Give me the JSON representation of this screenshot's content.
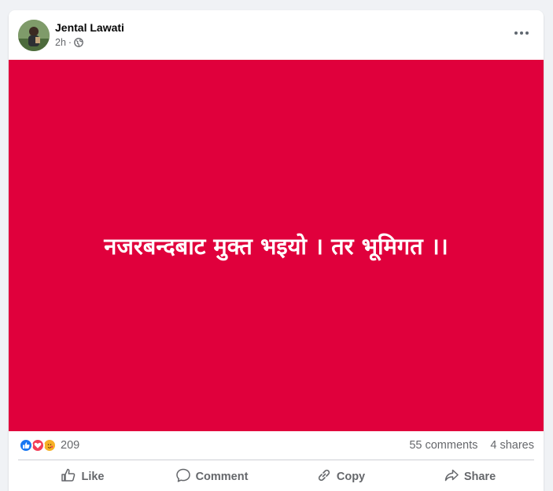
{
  "post": {
    "author": "Jental Lawati",
    "time": "2h",
    "separator": "·",
    "background_color": "#e0003c",
    "text": "नजरबन्दबाट मुक्त भइयो । तर भूमिगत ।।"
  },
  "stats": {
    "reaction_count": "209",
    "comments": "55 comments",
    "shares": "4 shares",
    "reactions": [
      "like-icon",
      "love-icon",
      "care-icon"
    ]
  },
  "actions": {
    "like": "Like",
    "comment": "Comment",
    "copy": "Copy",
    "share": "Share"
  },
  "colors": {
    "like_blue": "#1877f2",
    "love_red": "#f33e58",
    "care_yellow": "#f7b125"
  }
}
